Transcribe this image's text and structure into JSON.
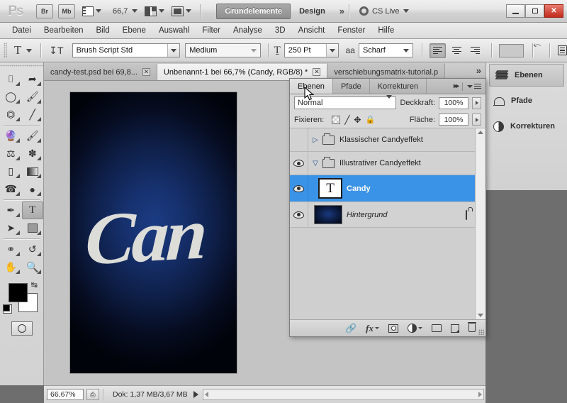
{
  "app": {
    "logo": "Ps",
    "bridge_label": "Br",
    "minibridge_label": "Mb",
    "zoom_level": "66,7",
    "workspace_tabs": [
      {
        "label": "Grundelemente",
        "active": true
      },
      {
        "label": "Design",
        "active": false
      }
    ],
    "more_workspaces": "»",
    "cs_live": "CS Live",
    "window_buttons": {
      "minimize": "—",
      "restore": "❐",
      "close": "✕"
    }
  },
  "menubar": {
    "items": [
      "Datei",
      "Bearbeiten",
      "Bild",
      "Ebene",
      "Auswahl",
      "Filter",
      "Analyse",
      "3D",
      "Ansicht",
      "Fenster",
      "Hilfe"
    ]
  },
  "options_bar": {
    "tool_icon": "type-tool-icon",
    "orientation_icon": "text-orientation-icon",
    "font_family": "Brush Script Std",
    "font_style": "Medium",
    "font_size": "250 Pt",
    "antialias_label": "aa",
    "antialias": "Scharf",
    "align": [
      "align-left",
      "align-center",
      "align-right"
    ],
    "align_active": 0,
    "color_swatch": "#c9c9c9",
    "warp_label": "warp-text-icon",
    "panel_toggle_label": "character-panel-icon"
  },
  "tools": {
    "rows": [
      [
        "marquee-tool",
        "move-tool"
      ],
      [
        "lasso-tool",
        "quick-select-tool"
      ],
      [
        "crop-tool",
        "eyedropper-tool"
      ],
      [
        "healing-brush-tool",
        "brush-tool"
      ],
      [
        "clone-stamp-tool",
        "history-brush-tool"
      ],
      [
        "eraser-tool",
        "gradient-tool"
      ],
      [
        "blur-tool",
        "dodge-tool"
      ],
      [
        "pen-tool",
        "type-tool"
      ],
      [
        "path-selection-tool",
        "shape-tool"
      ],
      [
        "3d-rotate-tool",
        "3d-orbit-tool"
      ],
      [
        "hand-tool",
        "zoom-tool"
      ]
    ],
    "selected": "type-tool",
    "foreground_color": "#000000",
    "background_color": "#ffffff",
    "quickmask_label": "quick-mask-icon"
  },
  "documents": {
    "tabs": [
      {
        "title": "candy-test.psd bei 69,8...",
        "active": false,
        "close": "✕"
      },
      {
        "title": "Unbenannt-1 bei 66,7% (Candy, RGB/8) *",
        "active": true,
        "close": "✕"
      },
      {
        "title": "verschiebungsmatrix-tutorial.p",
        "active": false,
        "close": ""
      }
    ],
    "overflow": "»"
  },
  "canvas": {
    "text": "Can",
    "text_color": "#dcdcd8",
    "background_top": "#01030a",
    "background_center": "#1b3b82"
  },
  "status_bar": {
    "zoom": "66,67%",
    "preview_icon": "document-preview-icon",
    "doc_size": "Dok: 1,37 MB/3,67 MB",
    "expand_arrow": "▶"
  },
  "layers_panel": {
    "tabs": [
      {
        "label": "Ebenen",
        "active": true
      },
      {
        "label": "Pfade",
        "active": false
      },
      {
        "label": "Korrekturen",
        "active": false
      }
    ],
    "collapse_icon": "collapse-panel-icon",
    "menu_icon": "panel-menu-icon",
    "blend_mode": "Normal",
    "opacity_label": "Deckkraft:",
    "opacity_value": "100%",
    "lock_label": "Fixieren:",
    "fill_label": "Fläche:",
    "fill_value": "100%",
    "lock_icons": [
      "lock-transparency-icon",
      "lock-paint-icon",
      "lock-position-icon",
      "lock-all-icon"
    ],
    "rows": [
      {
        "name": "Klassischer Candyeffekt",
        "type": "group",
        "visible": false,
        "expanded": false,
        "selected": false,
        "locked": false,
        "italic": false
      },
      {
        "name": "Illustrativer Candyeffekt",
        "type": "group",
        "visible": true,
        "expanded": true,
        "selected": false,
        "locked": false,
        "italic": false
      },
      {
        "name": "Candy",
        "type": "text",
        "visible": true,
        "selected": true,
        "locked": false,
        "italic": false,
        "thumb_glyph": "T"
      },
      {
        "name": "Hintergrund",
        "type": "background",
        "visible": true,
        "selected": false,
        "locked": true,
        "italic": true
      }
    ],
    "footer_icons": [
      "link-layers-icon",
      "layer-style-icon",
      "add-mask-icon",
      "adjustment-layer-icon",
      "new-group-icon",
      "new-layer-icon",
      "delete-layer-icon"
    ],
    "footer_fx_label": "fx",
    "scroll_up": "scroll-up-arrow",
    "scroll_down": "scroll-down-arrow"
  },
  "dock": {
    "items": [
      {
        "label": "Ebenen",
        "icon": "layers-icon",
        "active": true
      },
      {
        "label": "Pfade",
        "icon": "paths-icon",
        "active": false
      },
      {
        "label": "Korrekturen",
        "icon": "adjustments-icon",
        "active": false
      }
    ]
  }
}
